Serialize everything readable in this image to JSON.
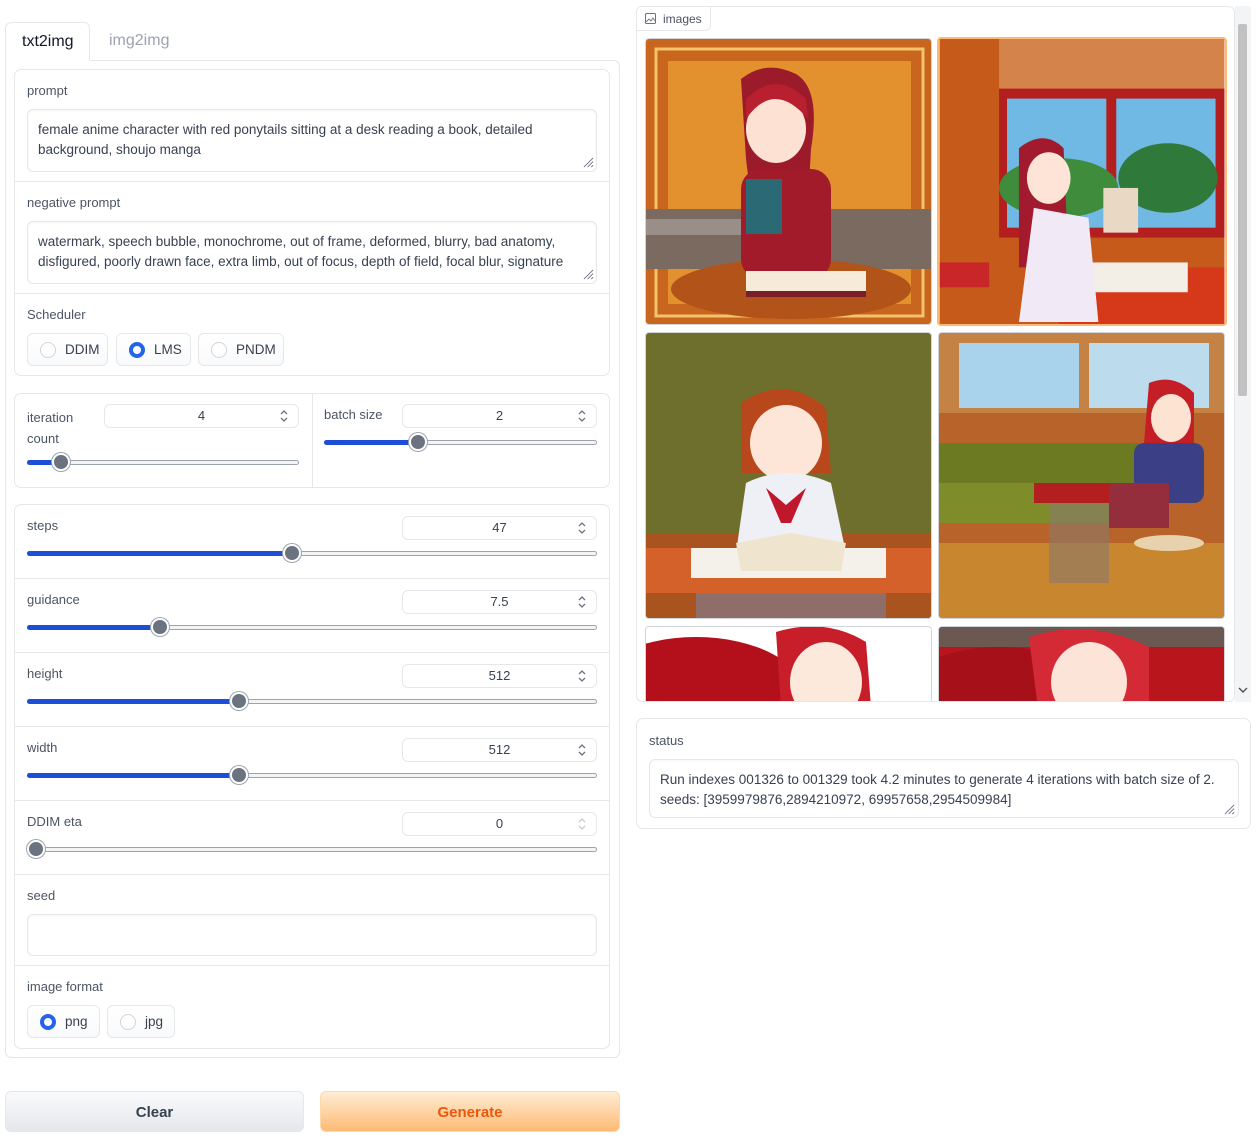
{
  "tabs": [
    {
      "label": "txt2img",
      "active": true
    },
    {
      "label": "img2img",
      "active": false
    }
  ],
  "prompt": {
    "label": "prompt",
    "value": "female anime character with red ponytails sitting at a desk reading a book, detailed background, shoujo manga"
  },
  "negative_prompt": {
    "label": "negative prompt",
    "value": "watermark, speech bubble, monochrome, out of frame, deformed, blurry, bad anatomy, disfigured, poorly drawn face, extra limb, out of focus, depth of field, focal blur, signature"
  },
  "scheduler": {
    "label": "Scheduler",
    "options": [
      "DDIM",
      "LMS",
      "PNDM"
    ],
    "selected": "LMS"
  },
  "iteration_count": {
    "label_line1": "iteration",
    "label_line2": "count",
    "value": "4",
    "min": 1,
    "max": 32
  },
  "batch_size": {
    "label": "batch size",
    "value": "2",
    "min": 1,
    "max": 4
  },
  "steps": {
    "label": "steps",
    "value": "47",
    "min": 1,
    "max": 100
  },
  "guidance": {
    "label": "guidance",
    "value": "7.5",
    "min": 1,
    "max": 30
  },
  "height": {
    "label": "height",
    "value": "512",
    "min": 64,
    "max": 1280
  },
  "width": {
    "label": "width",
    "value": "512",
    "min": 64,
    "max": 1280
  },
  "ddim_eta": {
    "label": "DDIM eta",
    "value": "0",
    "min": 0,
    "max": 1
  },
  "seed": {
    "label": "seed",
    "value": ""
  },
  "image_format": {
    "label": "image format",
    "options": [
      "png",
      "jpg"
    ],
    "selected": "png"
  },
  "buttons": {
    "clear": "Clear",
    "generate": "Generate"
  },
  "gallery": {
    "label": "images",
    "icon": "image-icon",
    "selected_index": 1
  },
  "status": {
    "label": "status",
    "value": "Run indexes 001326 to 001329 took 4.2 minutes to generate 4 iterations with batch size of 2. seeds: [3959979876,2894210972,  69957658,2954509984]"
  },
  "colors": {
    "accent": "#2563eb",
    "slider_fill": "#1d4ed8",
    "generate_text": "#ea580c",
    "selected_border": "#fdba74"
  }
}
